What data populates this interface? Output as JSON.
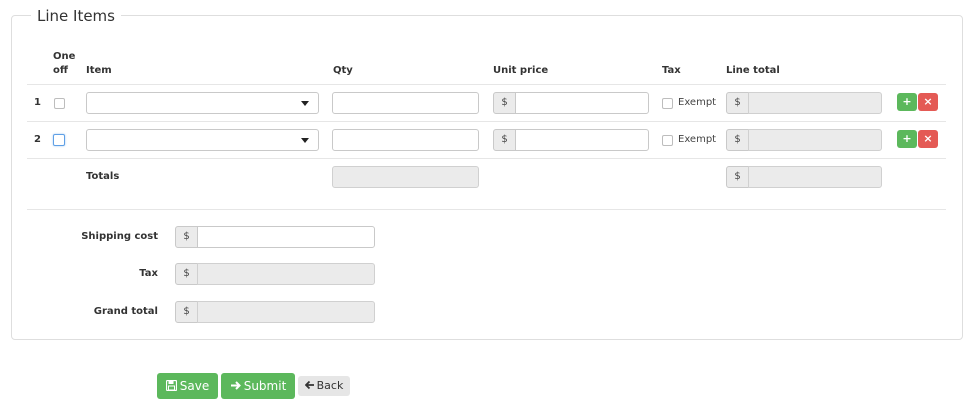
{
  "section": {
    "legend": "Line Items"
  },
  "headers": {
    "one_off": "One off",
    "item": "Item",
    "qty": "Qty",
    "unit_price": "Unit price",
    "tax": "Tax",
    "line_total": "Line total"
  },
  "rows": [
    {
      "num": "1",
      "exempt_label": "Exempt",
      "currency": "$",
      "add_icon": "+",
      "remove_icon": "×"
    },
    {
      "num": "2",
      "exempt_label": "Exempt",
      "currency": "$",
      "add_icon": "+",
      "remove_icon": "×"
    }
  ],
  "totals": {
    "label": "Totals",
    "currency": "$"
  },
  "summary": {
    "shipping_label": "Shipping cost",
    "tax_label": "Tax",
    "grand_label": "Grand total",
    "currency": "$"
  },
  "actions": {
    "save": "Save",
    "submit": "Submit",
    "back": "Back",
    "save_icon": "floppy-disk-icon",
    "submit_icon": "arrow-right-icon",
    "back_icon": "arrow-left-icon"
  },
  "colors": {
    "green": "#5cb85c",
    "red": "#e45a55",
    "focus": "#5fa0e6"
  }
}
